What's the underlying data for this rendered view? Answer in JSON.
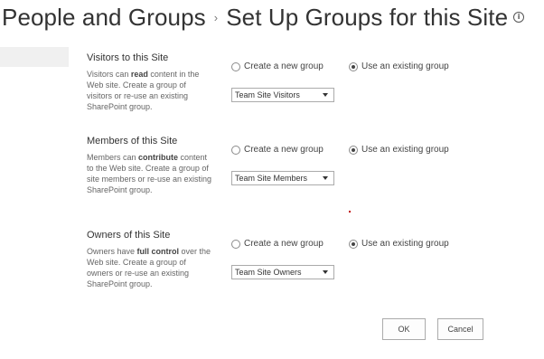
{
  "header": {
    "breadcrumb_root": "People and Groups",
    "separator": "›",
    "page_title": "Set Up Groups for this Site",
    "info_icon": "info-icon"
  },
  "sections": [
    {
      "title": "Visitors to this Site",
      "desc_pre": "Visitors can ",
      "desc_bold": "read",
      "desc_post": " content in the Web site. Create a group of visitors or re-use an existing SharePoint group.",
      "option_new": "Create a new group",
      "option_existing": "Use an existing group",
      "selected": "existing",
      "dropdown_value": "Team Site Visitors"
    },
    {
      "title": "Members of this Site",
      "desc_pre": "Members can ",
      "desc_bold": "contribute",
      "desc_post": " content to the Web site. Create a group of site members or re-use an existing SharePoint group.",
      "option_new": "Create a new group",
      "option_existing": "Use an existing group",
      "selected": "existing",
      "dropdown_value": "Team Site Members"
    },
    {
      "title": "Owners of this Site",
      "desc_pre": "Owners have ",
      "desc_bold": "full control",
      "desc_post": " over the Web site. Create a group of owners or re-use an existing SharePoint group.",
      "option_new": "Create a new group",
      "option_existing": "Use an existing group",
      "selected": "existing",
      "dropdown_value": "Team Site Owners"
    }
  ],
  "buttons": {
    "ok": "OK",
    "cancel": "Cancel"
  },
  "colors": {
    "title_text": "#333333",
    "body_text": "#444444",
    "nav_highlight": "#f0f0f0"
  }
}
